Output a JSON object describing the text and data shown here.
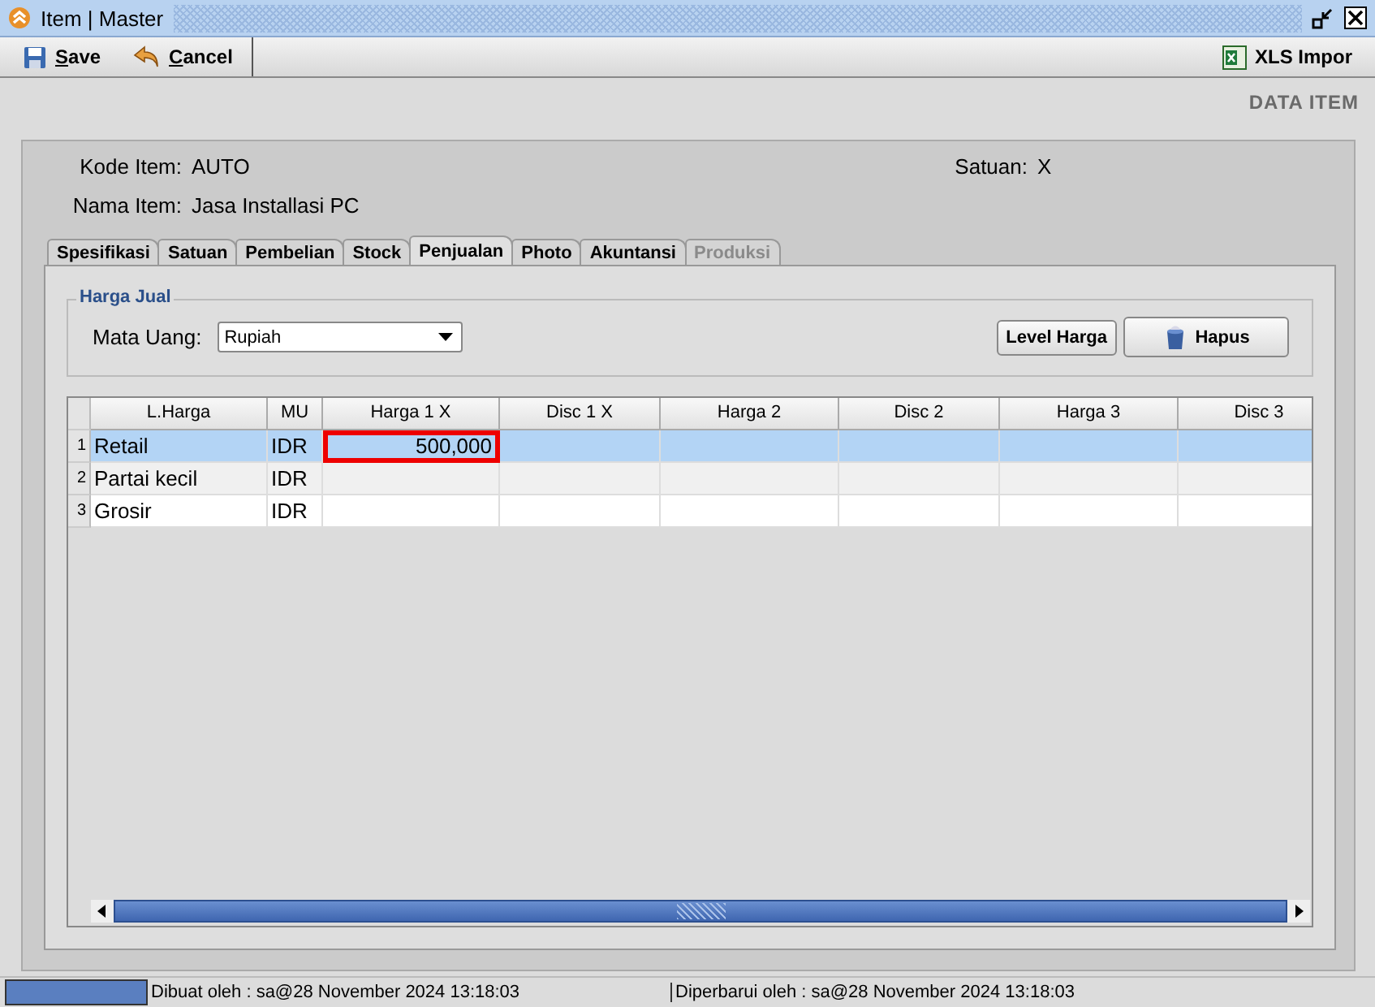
{
  "window": {
    "title": "Item | Master"
  },
  "toolbar": {
    "buttons": [
      {
        "label": "Save",
        "kind": "save"
      },
      {
        "label": "Cancel",
        "kind": "cancel"
      }
    ],
    "import_button": "XLS Impor"
  },
  "section_title": "DATA ITEM",
  "fields": {
    "kode_item": {
      "label": "Kode Item:",
      "value": "AUTO"
    },
    "nama_item": {
      "label": "Nama Item:",
      "value": "Jasa Installasi PC"
    },
    "satuan": {
      "label": "Satuan:",
      "value": "X"
    }
  },
  "tabs": [
    {
      "label": "Spesifikasi",
      "selected": false,
      "disabled": false
    },
    {
      "label": "Satuan",
      "selected": false,
      "disabled": false
    },
    {
      "label": "Pembelian",
      "selected": false,
      "disabled": false
    },
    {
      "label": "Stock",
      "selected": false,
      "disabled": false
    },
    {
      "label": "Penjualan",
      "selected": true,
      "disabled": false
    },
    {
      "label": "Photo",
      "selected": false,
      "disabled": false
    },
    {
      "label": "Akuntansi",
      "selected": false,
      "disabled": false
    },
    {
      "label": "Produksi",
      "selected": false,
      "disabled": true
    }
  ],
  "harga_jual": {
    "title": "Harga Jual",
    "currency_label": "Mata Uang:",
    "currency_value": "Rupiah",
    "buttons": [
      "Level Harga",
      "Hapus"
    ]
  },
  "table": {
    "columns": [
      "L.Harga",
      "MU",
      "Harga 1 X",
      "Disc 1 X",
      "Harga 2",
      "Disc 2",
      "Harga 3",
      "Disc 3"
    ],
    "rows": [
      {
        "number": "1",
        "cells": [
          "Retail",
          "IDR",
          "500,000"
        ],
        "selected": true,
        "focused_cell": true
      },
      {
        "number": "2",
        "cells": [
          "Partai kecil",
          "IDR"
        ],
        "selected": false,
        "focused_cell": false
      },
      {
        "number": "3",
        "cells": [
          "Grosir",
          "IDR"
        ],
        "selected": false,
        "focused_cell": false
      }
    ]
  },
  "status_bar": {
    "created": "Dibuat oleh : sa@28 November 2024  13:18:03",
    "updated": "Diperbarui oleh : sa@28 November 2024  13:18:03"
  }
}
